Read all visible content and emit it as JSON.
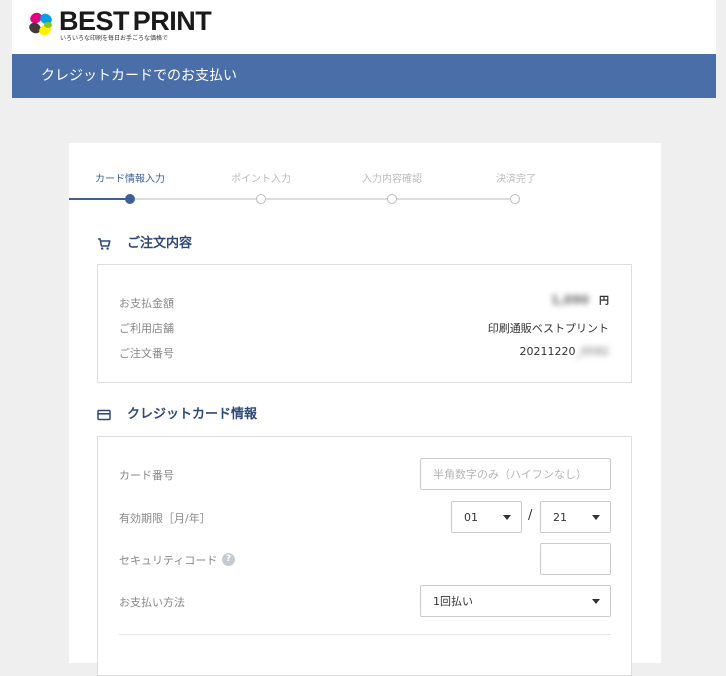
{
  "header": {
    "logo_best": "BEST",
    "logo_print": "PRINT",
    "logo_tagline": "いろいろな印刷を毎日お手ごろな価格で"
  },
  "page_title": "クレジットカードでのお支払い",
  "steps": [
    {
      "label": "カード情報入力",
      "active": true
    },
    {
      "label": "ポイント入力",
      "active": false
    },
    {
      "label": "入力内容確認",
      "active": false
    },
    {
      "label": "決済完了",
      "active": false
    }
  ],
  "order": {
    "title": "ご注文内容",
    "amount_label": "お支払金額",
    "amount_value": "1,090",
    "amount_unit": "円",
    "store_label": "ご利用店舗",
    "store_value": "印刷通販ベストプリント",
    "order_no_label": "ご注文番号",
    "order_no_value": "20211220",
    "order_no_hidden": "_0592"
  },
  "card": {
    "title": "クレジットカード情報",
    "number_label": "カード番号",
    "number_placeholder": "半角数字のみ（ハイフンなし）",
    "expiry_label": "有効期限［月/年］",
    "expiry_month": "01",
    "expiry_separator": "/",
    "expiry_year": "21",
    "security_label": "セキュリティコード",
    "security_help": "?",
    "payment_label": "お支払い方法",
    "payment_value": "1回払い"
  },
  "colors": {
    "accent": "#4a6fa8",
    "heading": "#2f4a78",
    "step_active": "#3e5f96"
  }
}
